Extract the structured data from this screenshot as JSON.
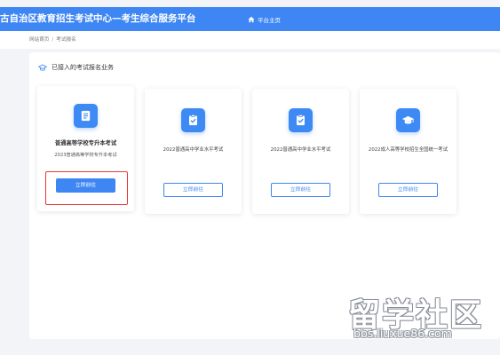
{
  "header": {
    "site_title": "古自治区教育招生考试中心—考生综合服务平台",
    "home_link": "平台主页",
    "home_icon": "home-icon",
    "bg_color": "#3d86f3"
  },
  "breadcrumb": {
    "home": "网站首页",
    "separator": "/",
    "current": "考试报名"
  },
  "panel": {
    "title": "已接入的考试报名业务",
    "title_icon": "graduation-cap-outline-icon"
  },
  "cards": [
    {
      "title": "普通高等学校专升本考试",
      "subtitle": "2023普通高等学校专升本考试",
      "button": "立即前往",
      "icon": "document-list-icon",
      "button_style": "filled"
    },
    {
      "label": "2022普通高中学业水平考试",
      "button": "立即前往",
      "icon": "clipboard-check-icon",
      "button_style": "outline"
    },
    {
      "label": "2022普通高中学业水平考试",
      "button": "立即前往",
      "icon": "clipboard-check-icon",
      "button_style": "outline"
    },
    {
      "label": "2022成人高等学校招生全国统一考试",
      "button": "立即前往",
      "icon": "graduation-cap-icon",
      "button_style": "outline"
    }
  ],
  "watermark": {
    "text": "留学社区",
    "url": "bbs.liuxue86.com"
  },
  "colors": {
    "accent": "#3d86f3",
    "highlight": "#e53935",
    "page_bg": "#f3f4f7"
  }
}
